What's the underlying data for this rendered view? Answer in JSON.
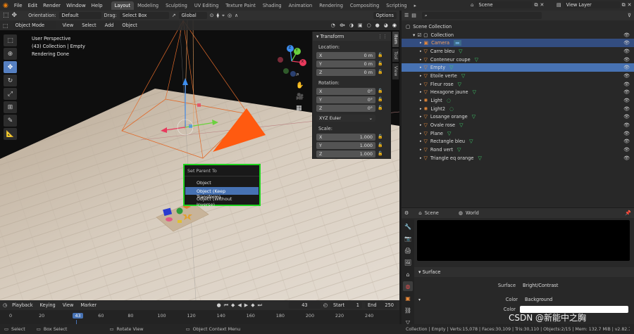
{
  "topbar": {
    "menus": [
      "File",
      "Edit",
      "Render",
      "Window",
      "Help"
    ],
    "workspaces": [
      "Layout",
      "Modeling",
      "Sculpting",
      "UV Editing",
      "Texture Paint",
      "Shading",
      "Animation",
      "Rendering",
      "Compositing",
      "Scripting"
    ],
    "active_workspace": "Layout",
    "scene": "Scene",
    "view_layer": "View Layer"
  },
  "tool_header": {
    "orientation_label": "Orientation:",
    "orientation_value": "Default",
    "drag_label": "Drag:",
    "drag_value": "Select Box",
    "transform_orientation": "Global",
    "options": "Options"
  },
  "viewport_header": {
    "mode": "Object Mode",
    "menus": [
      "View",
      "Select",
      "Add",
      "Object"
    ]
  },
  "viewport_overlay": {
    "line1": "User Perspective",
    "line2": "(43) Collection | Empty",
    "line3": "Rendering Done"
  },
  "gizmo": {
    "x": "X",
    "y": "Y",
    "z": "Z"
  },
  "npanel": {
    "title": "Transform",
    "location_label": "Location:",
    "location": [
      {
        "axis": "X",
        "value": "0 m"
      },
      {
        "axis": "Y",
        "value": "0 m"
      },
      {
        "axis": "Z",
        "value": "0 m"
      }
    ],
    "rotation_label": "Rotation:",
    "rotation": [
      {
        "axis": "X",
        "value": "0°"
      },
      {
        "axis": "Y",
        "value": "0°"
      },
      {
        "axis": "Z",
        "value": "0°"
      }
    ],
    "rotation_mode": "XYZ Euler",
    "scale_label": "Scale:",
    "scale": [
      {
        "axis": "X",
        "value": "1.000"
      },
      {
        "axis": "Y",
        "value": "1.000"
      },
      {
        "axis": "Z",
        "value": "1.000"
      }
    ],
    "tabs": [
      "Item",
      "Tool",
      "View"
    ]
  },
  "popup": {
    "title": "Set Parent To",
    "items": [
      "Object",
      "Object (Keep Transform)",
      "Object (Without Inverse)"
    ],
    "selected_index": 1
  },
  "outliner": {
    "search_placeholder": "",
    "root": "Scene Collection",
    "collection": "Collection",
    "objects": [
      {
        "name": "Camera",
        "state": "selected"
      },
      {
        "name": "Carre bleu",
        "state": ""
      },
      {
        "name": "Conteneur coupe",
        "state": ""
      },
      {
        "name": "Empty",
        "state": "active"
      },
      {
        "name": "Etoile verte",
        "state": ""
      },
      {
        "name": "Fleur rose",
        "state": ""
      },
      {
        "name": "Hexagone jaune",
        "state": ""
      },
      {
        "name": "Light",
        "state": ""
      },
      {
        "name": "Light2",
        "state": ""
      },
      {
        "name": "Losange orange",
        "state": ""
      },
      {
        "name": "Ovale rose",
        "state": ""
      },
      {
        "name": "Plane",
        "state": ""
      },
      {
        "name": "Rectangle bleu",
        "state": ""
      },
      {
        "name": "Rond vert",
        "state": ""
      },
      {
        "name": "Triangle eq orange",
        "state": ""
      }
    ]
  },
  "properties": {
    "scene_tab": "Scene",
    "world_tab": "World",
    "section": "Surface",
    "surface_label": "Surface",
    "surface_value": "Bright/Contrast",
    "color_label": "Color",
    "color_value": "Background",
    "color2_label": "Color"
  },
  "timeline": {
    "menus": [
      "Playback",
      "Keying",
      "View",
      "Marker"
    ],
    "current_frame": "43",
    "start_label": "Start",
    "start": "1",
    "end_label": "End",
    "end": "250",
    "ticks": [
      "0",
      "20",
      "43",
      "60",
      "80",
      "100",
      "120",
      "140",
      "160",
      "180",
      "200",
      "220",
      "240"
    ]
  },
  "statusbar": {
    "select": "Select",
    "box_select": "Box Select",
    "rotate_view": "Rotate View",
    "context_menu": "Object Context Menu",
    "stats": "Collection | Empty | Verts:15,078 | Faces:30,109 | Tris:30,110 | Objects:2/15 | Mem: 132.7 MiB | v2.82.7",
    "watermark": "CSDN @新能中之胸"
  }
}
